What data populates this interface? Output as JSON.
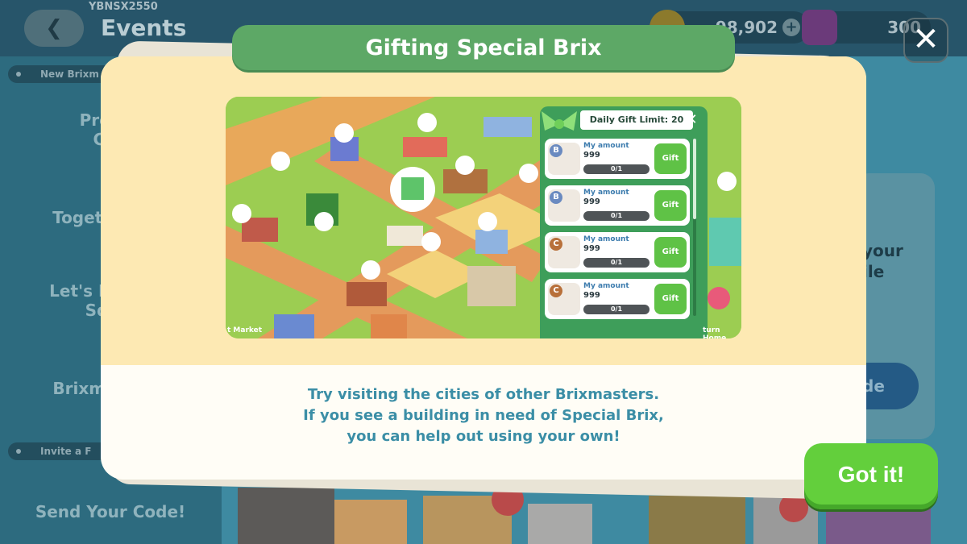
{
  "header": {
    "user_id": "YBNSX2550",
    "title": "Events",
    "coins": "98,902",
    "gems": "300"
  },
  "sidebar": {
    "pill_new": "New Brixm",
    "items": [
      "Protect",
      "Cam",
      "Together",
      "Let's Have",
      "Sq",
      "Brixma"
    ],
    "pill_invite": "Invite a F",
    "send_code": "Send Your Code!"
  },
  "right_card": {
    "line1": "your",
    "line2": "ile",
    "button": "de"
  },
  "modal": {
    "title": "Gifting Special Brix",
    "description_lines": [
      "Try visiting the cities of other Brixmasters.",
      "If you see a building in need of Special Brix,",
      "you can help out using your own!"
    ],
    "confirm_label": "Got it!"
  },
  "illustration": {
    "daily_limit": "Daily Gift Limit: 20",
    "rows": [
      {
        "badge": "B",
        "label": "My amount",
        "amount": "999",
        "progress": "0/1",
        "button": "Gift"
      },
      {
        "badge": "B",
        "label": "My amount",
        "amount": "999",
        "progress": "0/1",
        "button": "Gift"
      },
      {
        "badge": "C",
        "label": "My amount",
        "amount": "999",
        "progress": "0/1",
        "button": "Gift"
      },
      {
        "badge": "C",
        "label": "My amount",
        "amount": "999",
        "progress": "0/1",
        "button": "Gift"
      }
    ],
    "left_label": "t Market",
    "right_label": "turn Home"
  },
  "colors": {
    "title_green": "#5da866",
    "button_green": "#63cf3c",
    "description_blue": "#3b8ea6",
    "panel_green": "#3e9e5a"
  }
}
